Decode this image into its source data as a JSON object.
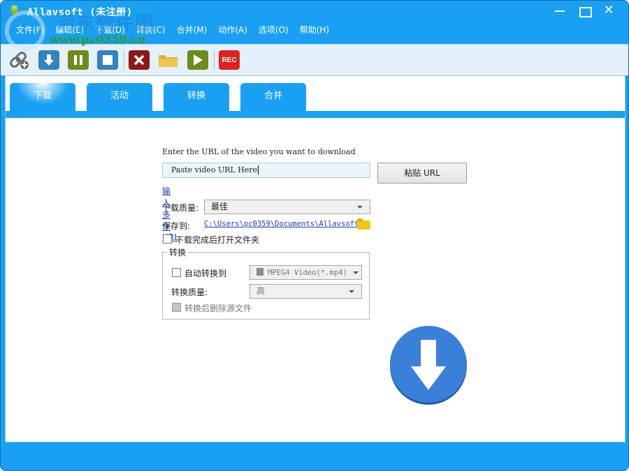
{
  "window": {
    "title": "Allavsoft (未注册)",
    "controls": {
      "minimize": "minimize",
      "maximize": "maximize",
      "close": "✕"
    }
  },
  "menu": [
    {
      "label": "文件(F)"
    },
    {
      "label": "编辑(E)"
    },
    {
      "label": "下载(D)"
    },
    {
      "label": "转换(C)"
    },
    {
      "label": "合并(M)"
    },
    {
      "label": "动作(A)"
    },
    {
      "label": "选项(O)"
    },
    {
      "label": "帮助(H)"
    }
  ],
  "toolbar": {
    "buttons": [
      {
        "name": "add-link",
        "icon": "link-plus-icon"
      },
      {
        "name": "download",
        "icon": "download-arrow-icon"
      },
      {
        "name": "pause",
        "icon": "pause-icon"
      },
      {
        "name": "stop",
        "icon": "stop-icon"
      },
      {
        "name": "delete",
        "icon": "x-icon"
      },
      {
        "name": "open-folder",
        "icon": "folder-icon"
      },
      {
        "name": "play",
        "icon": "play-icon"
      },
      {
        "name": "record",
        "icon": "rec-icon",
        "label": "REC"
      }
    ]
  },
  "tabs": [
    {
      "label": "下载",
      "active": true
    },
    {
      "label": "活动",
      "active": false
    },
    {
      "label": "转换",
      "active": false
    },
    {
      "label": "合并",
      "active": false
    }
  ],
  "download_form": {
    "prompt": "Enter the URL of the video you want to download",
    "url_input": {
      "value": "Paste video URL Here"
    },
    "paste_button": "粘贴 URL",
    "multi_url_link": "输入多个 URL",
    "quality_label": "下载质量:",
    "quality_value": "最佳",
    "save_label": "保存到:",
    "save_path": "C:\\Users\\pc0359\\Documents\\Allavsoft",
    "open_folder_checkbox": {
      "label": "下载完成后打开文件夹",
      "checked": false
    }
  },
  "convert_group": {
    "title": "转换",
    "auto_convert": {
      "label": "自动转换到",
      "checked": false
    },
    "format_value": "MPEG4 Video(*.mp4)",
    "quality_label": "转换质量:",
    "quality_value": "高",
    "delete_source": {
      "label": "转换后删除源文件",
      "checked": false,
      "disabled": true
    }
  },
  "watermark": {
    "site_name": "河东软件园",
    "url": "www.pc0359.cn"
  },
  "colors": {
    "accent": "#1aa0f2",
    "big_button": "#3a7fd8",
    "link": "#1a3fb5"
  }
}
